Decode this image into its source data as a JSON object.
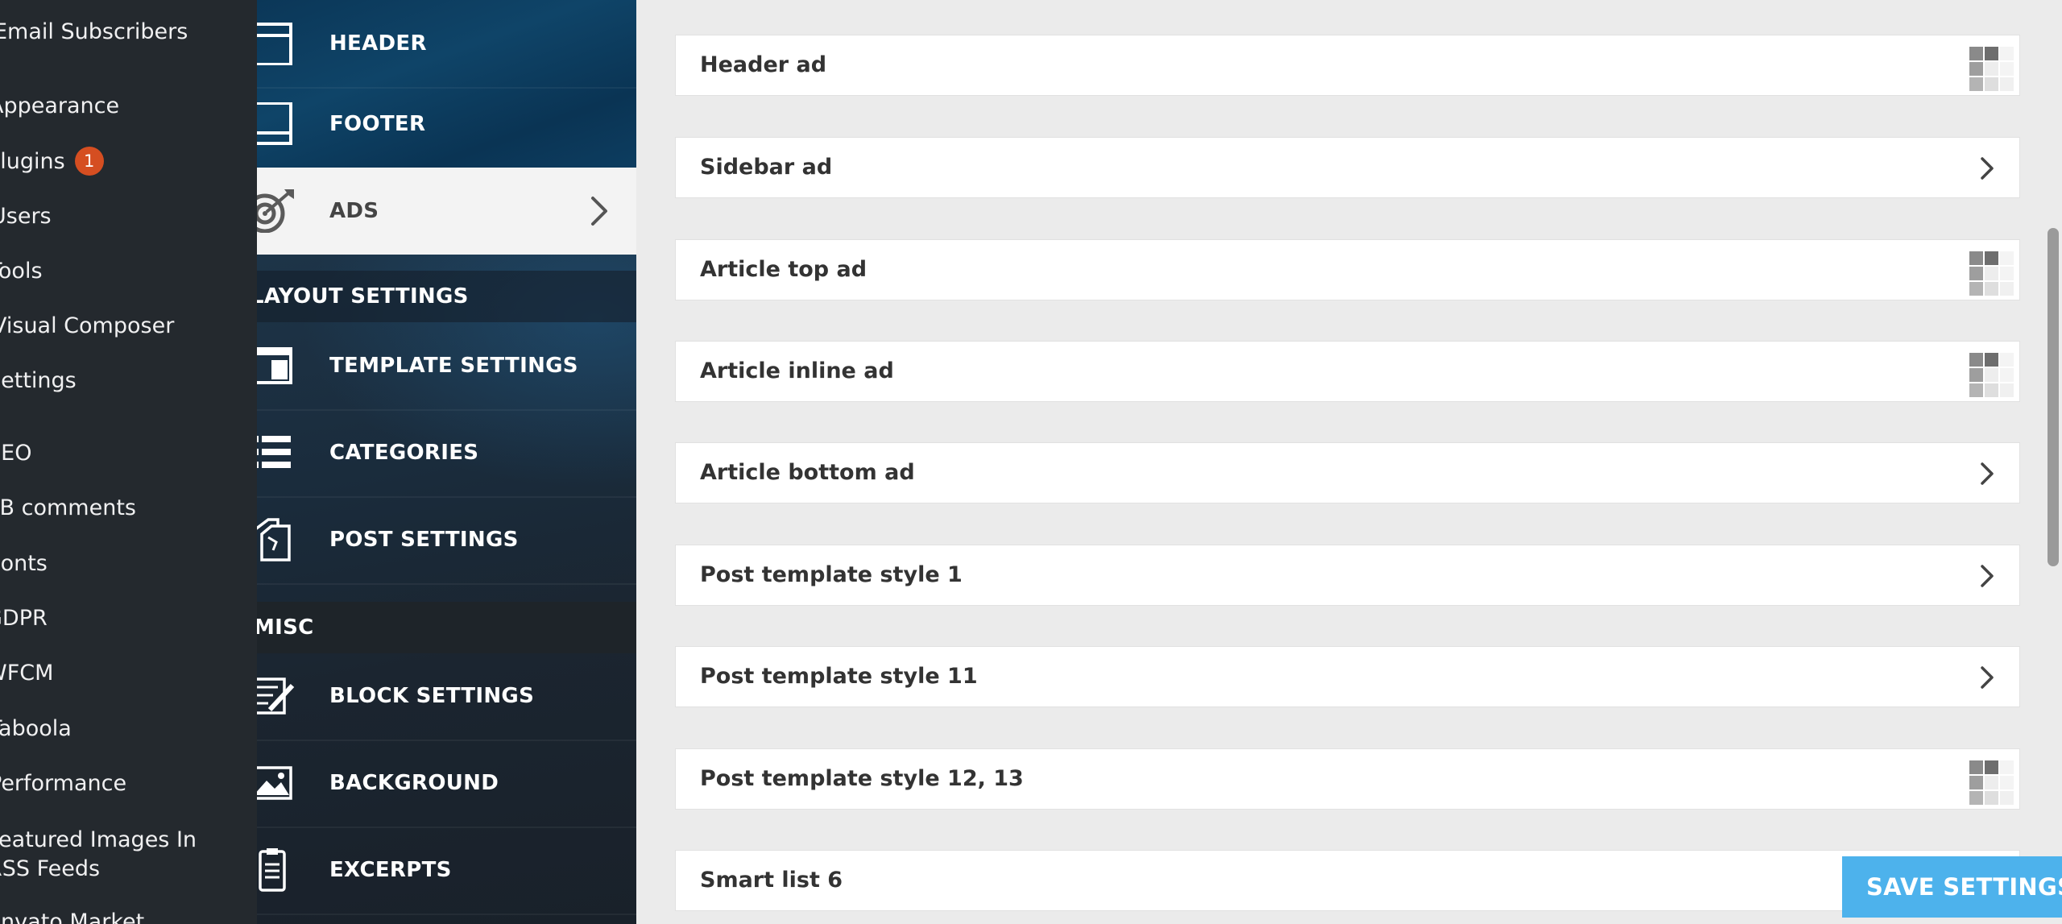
{
  "wp_sidebar": {
    "items": [
      {
        "label": "Email Subscribers"
      },
      {
        "label": "Appearance"
      },
      {
        "label": "Plugins",
        "badge": "1"
      },
      {
        "label": "Users"
      },
      {
        "label": "Tools"
      },
      {
        "label": "Visual Composer"
      },
      {
        "label": "Settings"
      },
      {
        "label": "SEO"
      },
      {
        "label": "FB comments"
      },
      {
        "label": "Fonts"
      },
      {
        "label": "GDPR"
      },
      {
        "label": "WFCM"
      },
      {
        "label": "Taboola"
      },
      {
        "label": "Performance"
      },
      {
        "label": "Featured Images In RSS Feeds"
      },
      {
        "label": "Envato Market"
      }
    ],
    "colors": {
      "background": "#24292e",
      "badge": "#d54e21"
    }
  },
  "panel_nav": {
    "items": [
      {
        "label": "HEADER",
        "icon": "header-layout-icon"
      },
      {
        "label": "FOOTER",
        "icon": "footer-layout-icon"
      },
      {
        "label": "ADS",
        "icon": "target-icon",
        "active": true
      },
      {
        "label": "TEMPLATE SETTINGS",
        "icon": "template-window-icon"
      },
      {
        "label": "CATEGORIES",
        "icon": "list-icon"
      },
      {
        "label": "POST SETTINGS",
        "icon": "documents-icon"
      },
      {
        "label": "BLOCK SETTINGS",
        "icon": "block-edit-icon"
      },
      {
        "label": "BACKGROUND",
        "icon": "image-landscape-icon"
      },
      {
        "label": "EXCERPTS",
        "icon": "clipboard-icon"
      }
    ],
    "sections": {
      "layout": "LAYOUT SETTINGS",
      "misc": "MISC"
    }
  },
  "ad_settings": {
    "rows": [
      {
        "label": "Header ad",
        "indicator": "loading-grid-icon"
      },
      {
        "label": "Sidebar ad",
        "indicator": "chevron-right-icon"
      },
      {
        "label": "Article top ad",
        "indicator": "loading-grid-icon"
      },
      {
        "label": "Article inline ad",
        "indicator": "loading-grid-icon"
      },
      {
        "label": "Article bottom ad",
        "indicator": "chevron-right-icon"
      },
      {
        "label": "Post template style 1",
        "indicator": "chevron-right-icon"
      },
      {
        "label": "Post template style 11",
        "indicator": "chevron-right-icon"
      },
      {
        "label": "Post template style 12, 13",
        "indicator": "loading-grid-icon"
      },
      {
        "label": "Smart list 6",
        "indicator": "chevron-right-icon"
      }
    ]
  },
  "actions": {
    "save_label": "SAVE SETTINGS",
    "save_color": "#4db2ec"
  }
}
